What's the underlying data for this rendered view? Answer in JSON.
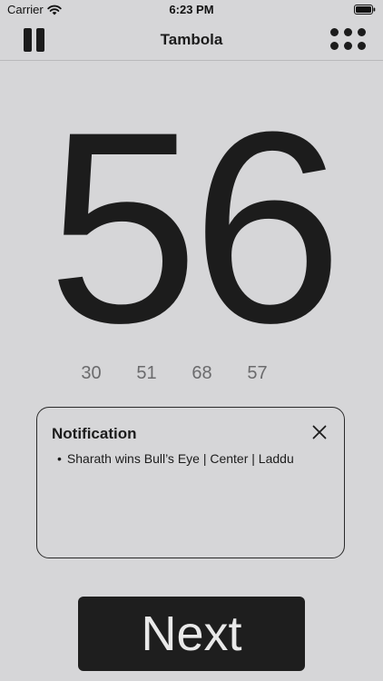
{
  "status_bar": {
    "carrier": "Carrier",
    "time": "6:23 PM"
  },
  "nav": {
    "title": "Tambola"
  },
  "game": {
    "current_number": "56",
    "previous_numbers": [
      "30",
      "51",
      "68",
      "57"
    ]
  },
  "notification": {
    "title": "Notification",
    "items": [
      "Sharath wins Bull’s Eye | Center | Laddu"
    ]
  },
  "actions": {
    "next_label": "Next"
  }
}
